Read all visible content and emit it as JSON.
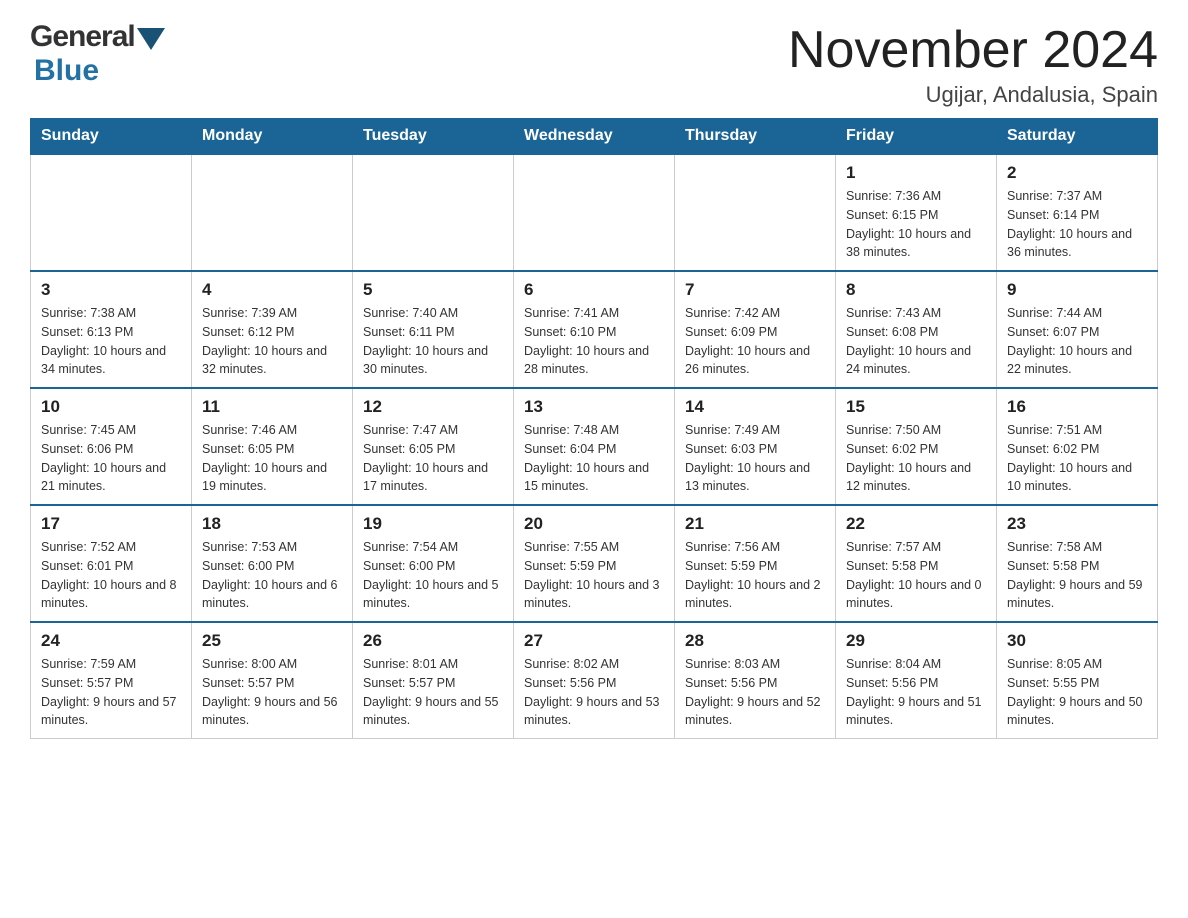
{
  "header": {
    "logo_general": "General",
    "logo_blue": "Blue",
    "month_title": "November 2024",
    "location": "Ugijar, Andalusia, Spain"
  },
  "calendar": {
    "days_of_week": [
      "Sunday",
      "Monday",
      "Tuesday",
      "Wednesday",
      "Thursday",
      "Friday",
      "Saturday"
    ],
    "weeks": [
      [
        {
          "day": "",
          "info": ""
        },
        {
          "day": "",
          "info": ""
        },
        {
          "day": "",
          "info": ""
        },
        {
          "day": "",
          "info": ""
        },
        {
          "day": "",
          "info": ""
        },
        {
          "day": "1",
          "info": "Sunrise: 7:36 AM\nSunset: 6:15 PM\nDaylight: 10 hours and 38 minutes."
        },
        {
          "day": "2",
          "info": "Sunrise: 7:37 AM\nSunset: 6:14 PM\nDaylight: 10 hours and 36 minutes."
        }
      ],
      [
        {
          "day": "3",
          "info": "Sunrise: 7:38 AM\nSunset: 6:13 PM\nDaylight: 10 hours and 34 minutes."
        },
        {
          "day": "4",
          "info": "Sunrise: 7:39 AM\nSunset: 6:12 PM\nDaylight: 10 hours and 32 minutes."
        },
        {
          "day": "5",
          "info": "Sunrise: 7:40 AM\nSunset: 6:11 PM\nDaylight: 10 hours and 30 minutes."
        },
        {
          "day": "6",
          "info": "Sunrise: 7:41 AM\nSunset: 6:10 PM\nDaylight: 10 hours and 28 minutes."
        },
        {
          "day": "7",
          "info": "Sunrise: 7:42 AM\nSunset: 6:09 PM\nDaylight: 10 hours and 26 minutes."
        },
        {
          "day": "8",
          "info": "Sunrise: 7:43 AM\nSunset: 6:08 PM\nDaylight: 10 hours and 24 minutes."
        },
        {
          "day": "9",
          "info": "Sunrise: 7:44 AM\nSunset: 6:07 PM\nDaylight: 10 hours and 22 minutes."
        }
      ],
      [
        {
          "day": "10",
          "info": "Sunrise: 7:45 AM\nSunset: 6:06 PM\nDaylight: 10 hours and 21 minutes."
        },
        {
          "day": "11",
          "info": "Sunrise: 7:46 AM\nSunset: 6:05 PM\nDaylight: 10 hours and 19 minutes."
        },
        {
          "day": "12",
          "info": "Sunrise: 7:47 AM\nSunset: 6:05 PM\nDaylight: 10 hours and 17 minutes."
        },
        {
          "day": "13",
          "info": "Sunrise: 7:48 AM\nSunset: 6:04 PM\nDaylight: 10 hours and 15 minutes."
        },
        {
          "day": "14",
          "info": "Sunrise: 7:49 AM\nSunset: 6:03 PM\nDaylight: 10 hours and 13 minutes."
        },
        {
          "day": "15",
          "info": "Sunrise: 7:50 AM\nSunset: 6:02 PM\nDaylight: 10 hours and 12 minutes."
        },
        {
          "day": "16",
          "info": "Sunrise: 7:51 AM\nSunset: 6:02 PM\nDaylight: 10 hours and 10 minutes."
        }
      ],
      [
        {
          "day": "17",
          "info": "Sunrise: 7:52 AM\nSunset: 6:01 PM\nDaylight: 10 hours and 8 minutes."
        },
        {
          "day": "18",
          "info": "Sunrise: 7:53 AM\nSunset: 6:00 PM\nDaylight: 10 hours and 6 minutes."
        },
        {
          "day": "19",
          "info": "Sunrise: 7:54 AM\nSunset: 6:00 PM\nDaylight: 10 hours and 5 minutes."
        },
        {
          "day": "20",
          "info": "Sunrise: 7:55 AM\nSunset: 5:59 PM\nDaylight: 10 hours and 3 minutes."
        },
        {
          "day": "21",
          "info": "Sunrise: 7:56 AM\nSunset: 5:59 PM\nDaylight: 10 hours and 2 minutes."
        },
        {
          "day": "22",
          "info": "Sunrise: 7:57 AM\nSunset: 5:58 PM\nDaylight: 10 hours and 0 minutes."
        },
        {
          "day": "23",
          "info": "Sunrise: 7:58 AM\nSunset: 5:58 PM\nDaylight: 9 hours and 59 minutes."
        }
      ],
      [
        {
          "day": "24",
          "info": "Sunrise: 7:59 AM\nSunset: 5:57 PM\nDaylight: 9 hours and 57 minutes."
        },
        {
          "day": "25",
          "info": "Sunrise: 8:00 AM\nSunset: 5:57 PM\nDaylight: 9 hours and 56 minutes."
        },
        {
          "day": "26",
          "info": "Sunrise: 8:01 AM\nSunset: 5:57 PM\nDaylight: 9 hours and 55 minutes."
        },
        {
          "day": "27",
          "info": "Sunrise: 8:02 AM\nSunset: 5:56 PM\nDaylight: 9 hours and 53 minutes."
        },
        {
          "day": "28",
          "info": "Sunrise: 8:03 AM\nSunset: 5:56 PM\nDaylight: 9 hours and 52 minutes."
        },
        {
          "day": "29",
          "info": "Sunrise: 8:04 AM\nSunset: 5:56 PM\nDaylight: 9 hours and 51 minutes."
        },
        {
          "day": "30",
          "info": "Sunrise: 8:05 AM\nSunset: 5:55 PM\nDaylight: 9 hours and 50 minutes."
        }
      ]
    ]
  },
  "colors": {
    "header_bg": "#1a6496",
    "header_text": "#ffffff",
    "border": "#cccccc",
    "row_border_top": "#1a6496"
  }
}
